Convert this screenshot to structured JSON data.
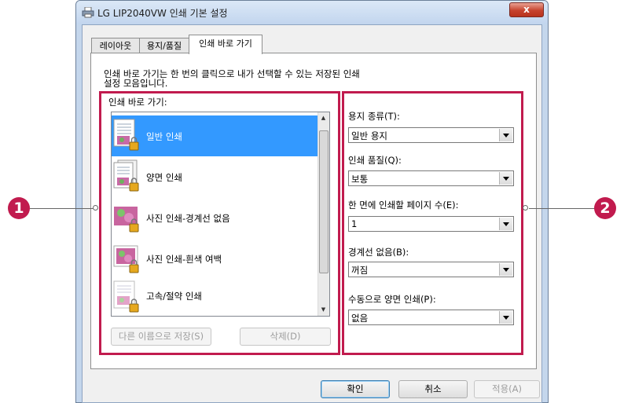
{
  "window": {
    "title": "LG LIP2040VW 인쇄 기본 설정",
    "close_glyph": "x"
  },
  "tabs": [
    {
      "label": "레이아웃"
    },
    {
      "label": "용지/품질"
    },
    {
      "label": "인쇄 바로 가기"
    }
  ],
  "shortcuts": {
    "description": "인쇄 바로 가기는 한 번의 클릭으로 내가 선택할 수 있는 저장된 인쇄 설정 모음입니다.",
    "list_label": "인쇄 바로 가기:",
    "items": [
      {
        "label": "일반 인쇄",
        "selected": true,
        "icon": "document-photo-icon"
      },
      {
        "label": "양면 인쇄",
        "selected": false,
        "icon": "duplex-document-icon"
      },
      {
        "label": "사진 인쇄-경계선 없음",
        "selected": false,
        "icon": "borderless-photo-icon"
      },
      {
        "label": "사진 인쇄-흰색 여백",
        "selected": false,
        "icon": "white-border-photo-icon"
      },
      {
        "label": "고속/절약 인쇄",
        "selected": false,
        "icon": "economy-document-icon"
      }
    ],
    "save_as_button": "다른 이름으로 저장(S)",
    "delete_button": "삭제(D)"
  },
  "settings": {
    "paper_type": {
      "label": "용지 종류(T):",
      "value": "일반 용지"
    },
    "print_quality": {
      "label": "인쇄 품질(Q):",
      "value": "보통"
    },
    "pages_per_sheet": {
      "label": "한 면에 인쇄할 페이지 수(E):",
      "value": "1"
    },
    "borderless": {
      "label": "경계선 없음(B):",
      "value": "꺼짐"
    },
    "manual_duplex": {
      "label": "수동으로 양면 인쇄(P):",
      "value": "없음"
    }
  },
  "footer": {
    "ok": "확인",
    "cancel": "취소",
    "apply": "적용(A)"
  },
  "callouts": {
    "left": "1",
    "right": "2"
  },
  "colors": {
    "highlight": "#c11b4e",
    "selection": "#3399ff",
    "titlebar": "#c4d6ec"
  }
}
